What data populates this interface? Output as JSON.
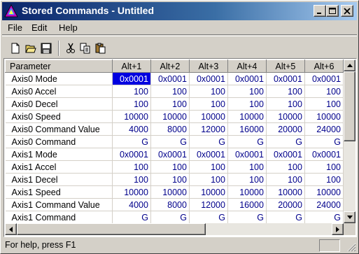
{
  "window": {
    "title": "Stored Commands - Untitled"
  },
  "menu": {
    "items": [
      "File",
      "Edit",
      "Help"
    ]
  },
  "toolbar": {
    "buttons": [
      "new-file-icon",
      "open-folder-icon",
      "save-disk-icon",
      "cut-icon",
      "copy-icon",
      "paste-icon"
    ]
  },
  "grid": {
    "headers": [
      "Parameter",
      "Alt+1",
      "Alt+2",
      "Alt+3",
      "Alt+4",
      "Alt+5",
      "Alt+6"
    ],
    "selected": {
      "row": 0,
      "col": 0
    },
    "rows": [
      {
        "name": "Axis0 Mode",
        "values": [
          "0x0001",
          "0x0001",
          "0x0001",
          "0x0001",
          "0x0001",
          "0x0001"
        ]
      },
      {
        "name": "Axis0 Accel",
        "values": [
          "100",
          "100",
          "100",
          "100",
          "100",
          "100"
        ]
      },
      {
        "name": "Axis0 Decel",
        "values": [
          "100",
          "100",
          "100",
          "100",
          "100",
          "100"
        ]
      },
      {
        "name": "Axis0 Speed",
        "values": [
          "10000",
          "10000",
          "10000",
          "10000",
          "10000",
          "10000"
        ]
      },
      {
        "name": "Axis0 Command Value",
        "values": [
          "4000",
          "8000",
          "12000",
          "16000",
          "20000",
          "24000"
        ]
      },
      {
        "name": "Axis0 Command",
        "values": [
          "G",
          "G",
          "G",
          "G",
          "G",
          "G"
        ]
      },
      {
        "name": "Axis1 Mode",
        "values": [
          "0x0001",
          "0x0001",
          "0x0001",
          "0x0001",
          "0x0001",
          "0x0001"
        ]
      },
      {
        "name": "Axis1 Accel",
        "values": [
          "100",
          "100",
          "100",
          "100",
          "100",
          "100"
        ]
      },
      {
        "name": "Axis1 Decel",
        "values": [
          "100",
          "100",
          "100",
          "100",
          "100",
          "100"
        ]
      },
      {
        "name": "Axis1 Speed",
        "values": [
          "10000",
          "10000",
          "10000",
          "10000",
          "10000",
          "10000"
        ]
      },
      {
        "name": "Axis1 Command Value",
        "values": [
          "4000",
          "8000",
          "12000",
          "16000",
          "20000",
          "24000"
        ]
      },
      {
        "name": "Axis1 Command",
        "values": [
          "G",
          "G",
          "G",
          "G",
          "G",
          "G"
        ]
      }
    ]
  },
  "status": {
    "text": "For help, press F1"
  },
  "colors": {
    "selection": "#0000e0",
    "value_text": "#00008b",
    "title_start": "#0a246a",
    "title_end": "#a6caf0"
  }
}
